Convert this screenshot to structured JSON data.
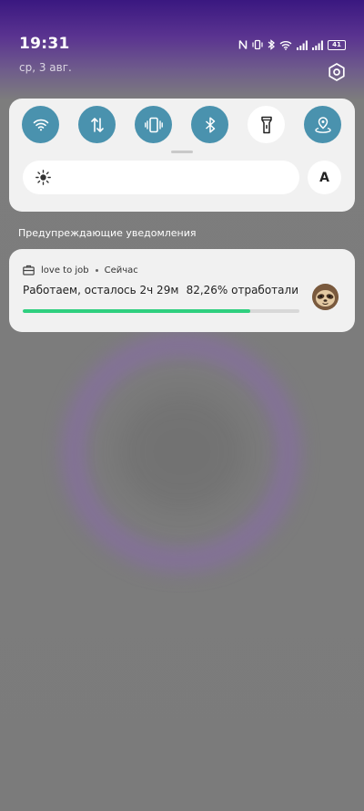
{
  "status_bar": {
    "time": "19:31",
    "date": "ср, 3 авг.",
    "battery": "41",
    "icons": [
      "nfc-icon",
      "vibrate-icon",
      "bluetooth-icon",
      "wifi-icon",
      "signal-icon",
      "signal-icon",
      "battery-icon"
    ]
  },
  "quick_settings": {
    "tiles": [
      {
        "name": "wifi",
        "icon": "wifi-icon",
        "active": true
      },
      {
        "name": "mobile-data",
        "icon": "data-arrows-icon",
        "active": true
      },
      {
        "name": "vibrate",
        "icon": "vibrate-icon",
        "active": true
      },
      {
        "name": "bluetooth",
        "icon": "bluetooth-icon",
        "active": true
      },
      {
        "name": "flashlight",
        "icon": "flashlight-icon",
        "active": false
      },
      {
        "name": "location",
        "icon": "location-icon",
        "active": true
      }
    ],
    "brightness_auto_label": "A"
  },
  "notifications": {
    "section_title": "Предупреждающие уведомления",
    "items": [
      {
        "app_name": "love to job",
        "time": "Сейчас",
        "message": "Работаем, осталось 2ч 29м",
        "percent_text": "82,26% отработали",
        "progress": 0.8226,
        "avatar_icon": "sloth-avatar"
      }
    ]
  },
  "colors": {
    "tile_active": "#4a92ae",
    "progress": "#2fcf7f",
    "panel": "#f1f1f1"
  }
}
